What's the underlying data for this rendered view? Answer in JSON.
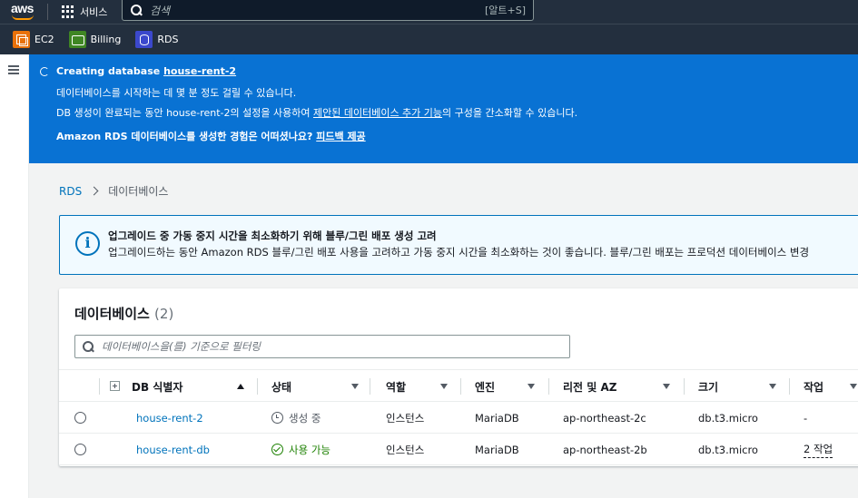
{
  "nav": {
    "logo_text": "aws",
    "services_label": "서비스",
    "search_placeholder": "검색",
    "search_shortcut": "[알트+S]"
  },
  "favorites": [
    {
      "label": "EC2",
      "icon": "ec2-icon"
    },
    {
      "label": "Billing",
      "icon": "billing-icon"
    },
    {
      "label": "RDS",
      "icon": "rds-icon"
    }
  ],
  "flash": {
    "title_prefix": "Creating database",
    "db_name": "house-rent-2",
    "line2": "데이터베이스를 시작하는 데 몇 분 정도 걸릴 수 있습니다.",
    "line3_prefix": "DB 생성이 완료되는 동안 house-rent-2의 설정을 사용하여",
    "line3_link": "제안된 데이터베이스 추가 기능",
    "line3_suffix": "의 구성을 간소화할 수 있습니다.",
    "feedback_question": "Amazon RDS 데이터베이스를 생성한 경험은 어떠셨나요?",
    "feedback_link": "피드백 제공",
    "color": "#0972d3"
  },
  "breadcrumb": {
    "root": "RDS",
    "current": "데이터베이스"
  },
  "info": {
    "title": "업그레이드 중 가동 중지 시간을 최소화하기 위해 블루/그린 배포 생성 고려",
    "body": "업그레이드하는 동안 Amazon RDS 블루/그린 배포 사용을 고려하고 가동 중지 시간을 최소화하는 것이 좋습니다. 블루/그린 배포는 프로덕션 데이터베이스 변경"
  },
  "databases": {
    "title": "데이터베이스",
    "count": "(2)",
    "filter_placeholder": "데이터베이스을(를) 기준으로 필터링",
    "columns": {
      "id": "DB 식별자",
      "status": "상태",
      "role": "역할",
      "engine": "엔진",
      "region": "리전 및 AZ",
      "size": "크기",
      "actions": "작업"
    },
    "rows": [
      {
        "id": "house-rent-2",
        "status": "생성 중",
        "role": "인스턴스",
        "engine": "MariaDB",
        "region": "ap-northeast-2c",
        "size": "db.t3.micro",
        "actions": "-"
      },
      {
        "id": "house-rent-db",
        "status": "사용 가능",
        "role": "인스턴스",
        "engine": "MariaDB",
        "region": "ap-northeast-2b",
        "size": "db.t3.micro",
        "actions": "2 작업"
      }
    ]
  }
}
